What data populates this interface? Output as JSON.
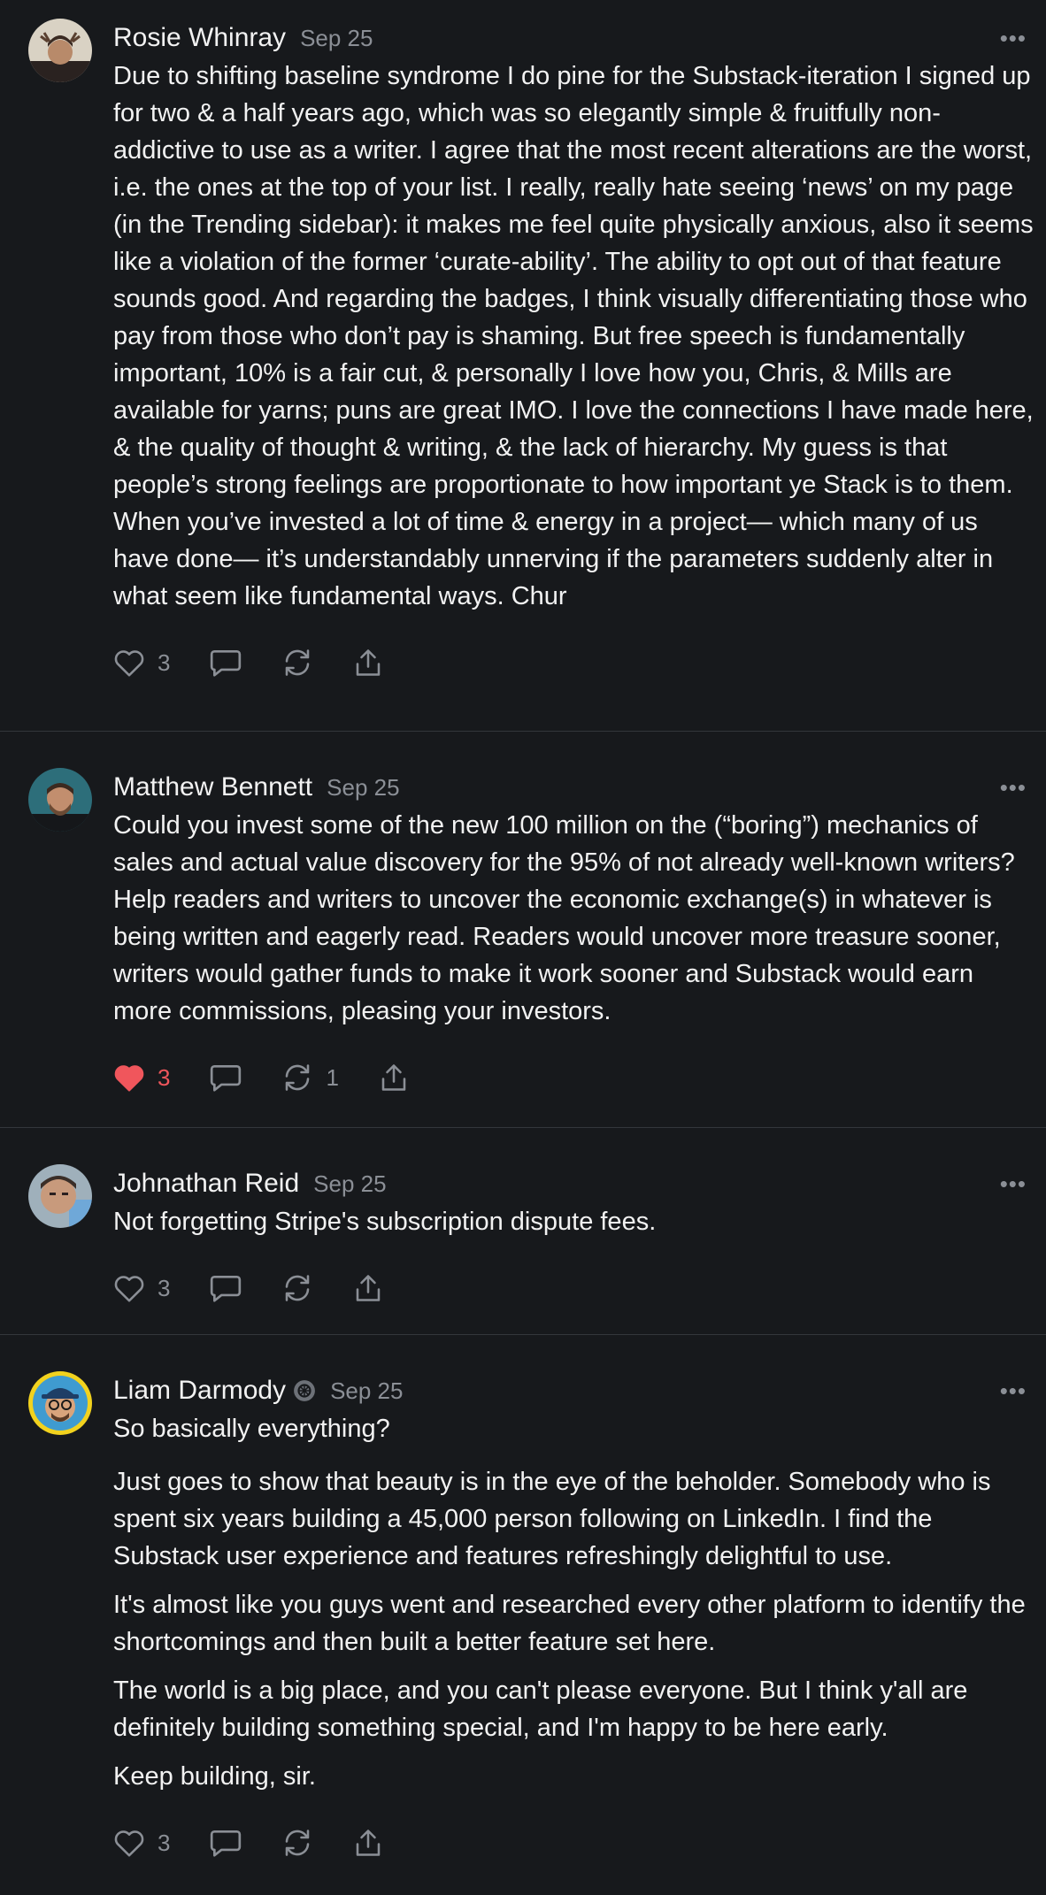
{
  "comments": [
    {
      "author": "Rosie Whinray",
      "date": "Sep 25",
      "paragraphs": [
        "Due to shifting baseline syndrome I do pine for the Substack-iteration I signed up for two & a half years ago, which was so elegantly simple & fruitfully non-addictive to use as a writer. I agree that the most recent alterations are the worst, i.e. the ones at the top of your list. I really, really hate seeing ‘news’ on my page (in the Trending sidebar): it makes me feel quite physically anxious, also it seems like a violation of the former ‘curate-ability’. The ability to opt out of that feature sounds good. And regarding the badges, I think visually differentiating those who pay from those who don’t pay is shaming. But free speech is fundamentally important, 10% is a fair cut, & personally I love how you, Chris, & Mills are available for yarns; puns are great IMO. I love the connections I have made here, & the quality of thought & writing, & the lack of hierarchy. My guess is that people’s strong feelings are proportionate to how important ye Stack is to them. When you’ve invested a lot of time & energy in a project— which many of us have done— it’s understandably unnerving if the parameters suddenly alter in what seem like fundamental ways. Chur"
      ],
      "likes": "3",
      "liked": false,
      "restacks": ""
    },
    {
      "author": "Matthew Bennett",
      "date": "Sep 25",
      "paragraphs": [
        "Could you invest some of the new 100 million on the (“boring”) mechanics of sales and actual value discovery for the 95% of not already well-known writers? Help readers and writers to uncover the economic exchange(s) in whatever is being written and eagerly read. Readers would uncover more treasure sooner, writers would gather funds to make it work sooner and Substack would earn more commissions, pleasing your investors."
      ],
      "likes": "3",
      "liked": true,
      "restacks": "1"
    },
    {
      "author": "Johnathan Reid",
      "date": "Sep 25",
      "paragraphs": [
        "Not forgetting Stripe's subscription dispute fees."
      ],
      "likes": "3",
      "liked": false,
      "restacks": ""
    },
    {
      "author": "Liam Darmody",
      "date": "Sep 25",
      "paragraphs": [
        "So basically everything?",
        "Just goes to show that beauty is in the eye of the beholder. Somebody who is spent six years building a 45,000 person following on LinkedIn. I find the Substack user experience and features refreshingly delightful to use.",
        "It's almost like you guys went and researched every other platform to identify the shortcomings and then built a better feature set here.",
        "The world is a big place, and you can't please everyone. But I think y'all are definitely building something special, and I'm happy to be here early.",
        "Keep building, sir."
      ],
      "likes": "3",
      "liked": false,
      "restacks": ""
    }
  ],
  "icons": {
    "like": "heart-icon",
    "comment": "speech-bubble-icon",
    "restack": "restack-arrows-icon",
    "share": "share-upload-icon",
    "more": "ellipsis-icon",
    "badge": "verified-badge-icon"
  },
  "colors": {
    "background": "#17191c",
    "text": "#f2f2f2",
    "muted": "#8b8f96",
    "divider": "#33363b",
    "like_active": "#f0565c"
  }
}
